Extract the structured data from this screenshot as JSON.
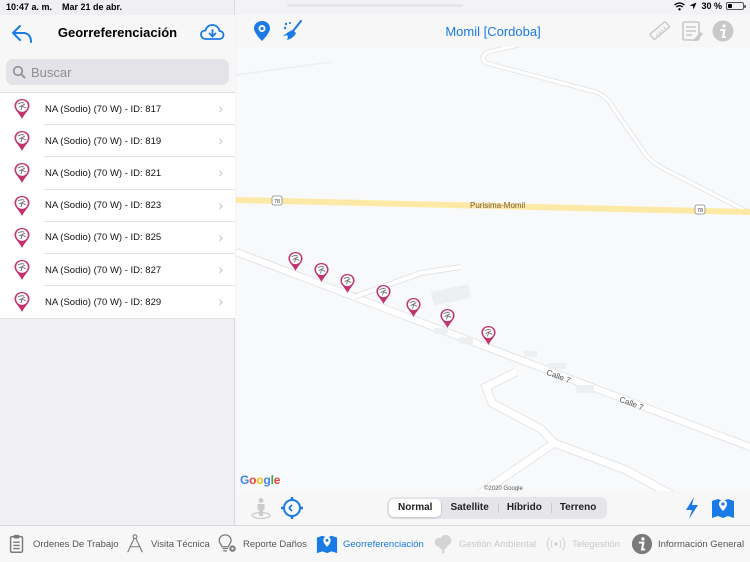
{
  "status_bar": {
    "time": "10:47 a. m.",
    "date": "Mar 21 de abr.",
    "battery_text": "30 %",
    "battery_level": 0.3
  },
  "left_panel": {
    "title": "Georreferenciación",
    "back_icon": "reply-arrow-icon",
    "download_icon": "cloud-download-icon",
    "search": {
      "placeholder": "Buscar",
      "value": ""
    },
    "items": [
      {
        "label": "NA (Sodio) (70 W) - ID: 817",
        "icon": "lamp-marker-icon"
      },
      {
        "label": "NA (Sodio) (70 W) - ID: 819",
        "icon": "lamp-marker-icon"
      },
      {
        "label": "NA (Sodio) (70 W) - ID: 821",
        "icon": "lamp-marker-icon"
      },
      {
        "label": "NA (Sodio) (70 W) - ID: 823",
        "icon": "lamp-marker-icon"
      },
      {
        "label": "NA (Sodio) (70 W) - ID: 825",
        "icon": "lamp-marker-icon"
      },
      {
        "label": "NA (Sodio) (70 W) - ID: 827",
        "icon": "lamp-marker-icon"
      },
      {
        "label": "NA (Sodio) (70 W) - ID: 829",
        "icon": "lamp-marker-icon"
      }
    ]
  },
  "map": {
    "title": "Momil [Cordoba]",
    "toolbar_icons": [
      "location-pin-icon",
      "broom-icon",
      "ruler-icon",
      "list-edit-icon",
      "info-icon"
    ],
    "road_labels": {
      "highway_name": "Purisima-Momil",
      "route_number": "78",
      "street_1": "Calle 7",
      "street_2": "Calle 7"
    },
    "attribution": {
      "logo": "Google",
      "copyright": "©2020 Google"
    },
    "map_types": [
      {
        "label": "Normal",
        "active": true
      },
      {
        "label": "Satellite",
        "active": false
      },
      {
        "label": "Híbrido",
        "active": false
      },
      {
        "label": "Terreno",
        "active": false
      }
    ],
    "bottom_icons": [
      "street-view-person-icon",
      "locate-me-icon",
      "lightning-icon",
      "map-pin-icon"
    ],
    "marker_count": 7
  },
  "tab_bar": {
    "tabs": [
      {
        "label": "Ordenes De Trabajo",
        "icon": "clipboard-icon",
        "state": "normal"
      },
      {
        "label": "Visita Técnica",
        "icon": "compass-tool-icon",
        "state": "normal"
      },
      {
        "label": "Reporte Daños",
        "icon": "bulb-gear-icon",
        "state": "normal"
      },
      {
        "label": "Georreferenciación",
        "icon": "map-pin-icon",
        "state": "active"
      },
      {
        "label": "Gestión Ambiental",
        "icon": "tree-icon",
        "state": "disabled"
      },
      {
        "label": "Telegestión",
        "icon": "antenna-icon",
        "state": "disabled"
      },
      {
        "label": "Información General",
        "icon": "info-icon",
        "state": "normal"
      }
    ]
  },
  "colors": {
    "accent": "#1a7ae6",
    "marker": "#c2336f",
    "highway": "#fde9a6",
    "map_bg": "#f8f9fa"
  }
}
